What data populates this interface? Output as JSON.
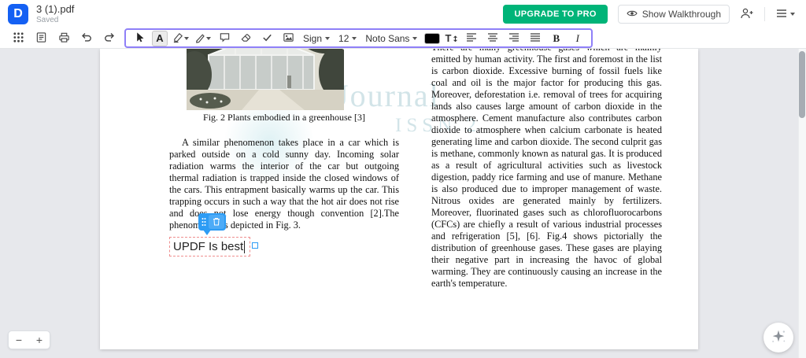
{
  "header": {
    "logo_letter": "D",
    "file_name": "3 (1).pdf",
    "save_status": "Saved",
    "upgrade_button": "UPGRADE TO PRO",
    "walkthrough_button": "Show Walkthrough"
  },
  "toolbar": {
    "text_tool": "A",
    "sign_label": "Sign",
    "font_size": "12",
    "font_name": "Noto Sans",
    "color_value": "#000000",
    "text_size_icon_letter": "T",
    "text_size_icon_arrows": "↕",
    "bold": "B",
    "italic": "I"
  },
  "page": {
    "figure_caption": "Fig. 2 Plants embodied in a greenhouse [3]",
    "left_paragraph": "A similar phenomenon takes place in a car which is parked outside on a cold sunny day. Incoming solar radiation warms the interior of the car but outgoing thermal radiation is trapped inside the closed windows of the cars. This entrapment basically warms up the car. This trapping occurs in such a way that the hot air does not rise and does not lose energy though convention [2].The phenomenon is depicted in Fig. 3.",
    "text_box_value": "UPDF Is best",
    "right_paragraph": "There are many greenhouse gases which are mainly emitted by human activity. The first and foremost in the list is carbon dioxide. Excessive burning of fossil fuels like coal and oil is the major factor for producing this gas. Moreover, deforestation i.e. removal of trees for acquiring lands also causes large amount of carbon dioxide in the atmosphere. Cement manufacture also contributes carbon dioxide to atmosphere when calcium carbonate is heated generating lime and carbon dioxide. The second culprit gas is methane, commonly known as natural gas. It is produced as a result of agricultural activities such as livestock digestion, paddy rice farming and use of manure. Methane is also produced due to improper management of waste. Nitrous oxides are generated mainly by fertilizers. Moreover, fluorinated gases such as chlorofluorocarbons (CFCs) are chiefly a result of various industrial processes and refrigeration [5], [6]. Fig.4 shows pictorially the distribution of greenhouse gases. These gases are playing their negative part in increasing the havoc of global warming. They are continuously causing an increase in the earth's temperature.",
    "watermark_line1": "Journal",
    "watermark_line2": "ISSN 2"
  },
  "zoom_controls": {
    "zoom_out": "−",
    "zoom_in": "+"
  },
  "colors": {
    "accent_blue": "#1460f3",
    "upgrade_green": "#00b478",
    "toolbar_highlight": "#8f80f8",
    "handle_blue": "#2d9cf4"
  }
}
